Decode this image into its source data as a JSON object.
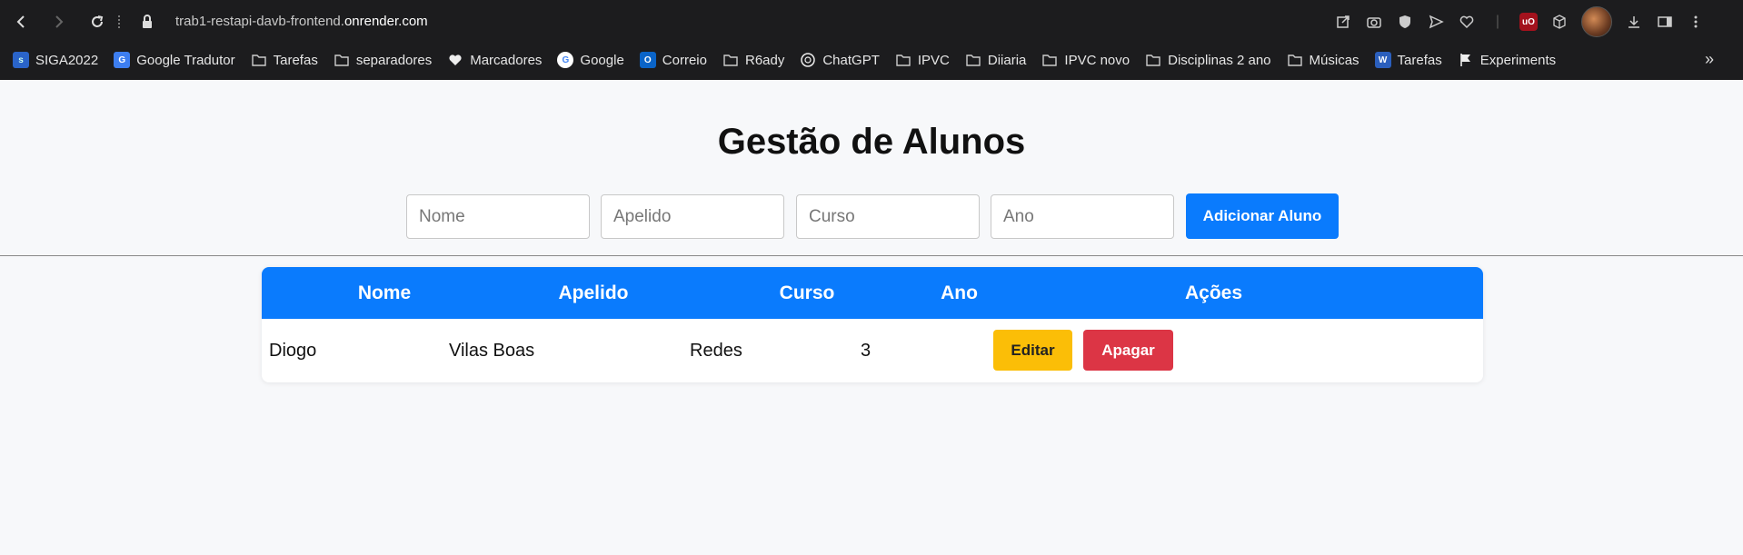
{
  "browser": {
    "url_prefix": "trab1-restapi-davb-frontend.",
    "url_domain": "onrender.com",
    "bookmarks": [
      {
        "label": "SIGA2022",
        "icon": "siga-icon"
      },
      {
        "label": "Google Tradutor",
        "icon": "translate-icon"
      },
      {
        "label": "Tarefas",
        "icon": "folder-icon"
      },
      {
        "label": "separadores",
        "icon": "folder-icon"
      },
      {
        "label": "Marcadores",
        "icon": "heart-icon"
      },
      {
        "label": "Google",
        "icon": "google-icon"
      },
      {
        "label": "Correio",
        "icon": "outlook-icon"
      },
      {
        "label": "R6ady",
        "icon": "folder-icon"
      },
      {
        "label": "ChatGPT",
        "icon": "chatgpt-icon"
      },
      {
        "label": "IPVC",
        "icon": "folder-icon"
      },
      {
        "label": "Diiaria",
        "icon": "folder-icon"
      },
      {
        "label": "IPVC novo",
        "icon": "folder-icon"
      },
      {
        "label": "Disciplinas 2 ano",
        "icon": "folder-icon"
      },
      {
        "label": "Músicas",
        "icon": "folder-icon"
      },
      {
        "label": "Tarefas",
        "icon": "word-icon"
      },
      {
        "label": "Experiments",
        "icon": "flag-icon"
      }
    ]
  },
  "page": {
    "title": "Gestão de Alunos",
    "form": {
      "nome_placeholder": "Nome",
      "apelido_placeholder": "Apelido",
      "curso_placeholder": "Curso",
      "ano_placeholder": "Ano",
      "add_label": "Adicionar Aluno"
    },
    "table": {
      "headers": [
        "Nome",
        "Apelido",
        "Curso",
        "Ano",
        "Ações"
      ],
      "rows": [
        {
          "nome": "Diogo",
          "apelido": "Vilas Boas",
          "curso": "Redes",
          "ano": "3",
          "edit_label": "Editar",
          "delete_label": "Apagar"
        }
      ]
    }
  },
  "colors": {
    "primary": "#0a7bfd",
    "edit": "#fbbe07",
    "delete": "#dc3545",
    "chrome": "#1c1c1e"
  }
}
